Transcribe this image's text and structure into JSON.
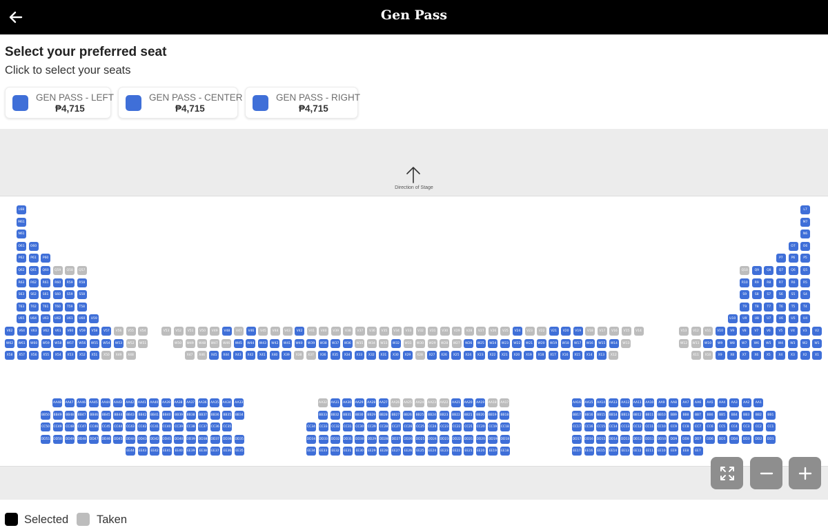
{
  "app": {
    "title": "Gen Pass"
  },
  "page": {
    "heading": "Select your preferred seat",
    "subheading": "Click to select your seats"
  },
  "tickets": [
    {
      "name": "GEN PASS - LEFT",
      "price": "₱4,715"
    },
    {
      "name": "GEN PASS - CENTER",
      "price": "₱4,715"
    },
    {
      "name": "GEN PASS - RIGHT",
      "price": "₱4,715"
    }
  ],
  "map": {
    "stage_label": "Direction of Stage",
    "zoom_buttons": [
      "fullscreen",
      "zoom-out",
      "zoom-in"
    ]
  },
  "legend": {
    "selected": "Selected",
    "taken": "Taken"
  },
  "colors": {
    "available": "#3f6fd8",
    "taken": "#bdbdbd",
    "selected": "#000000",
    "header": "#000000"
  },
  "icons": [
    "back-arrow-icon",
    "up-arrow-icon",
    "fullscreen-icon",
    "minus-icon",
    "plus-icon"
  ],
  "seat_map": {
    "left_wing": [
      {
        "row": "L",
        "seats": [
          "L68"
        ]
      },
      {
        "row": "M",
        "seats": [
          "M61"
        ]
      },
      {
        "row": "N",
        "seats": [
          "N61"
        ]
      },
      {
        "row": "O",
        "seats": [
          "O61",
          "O60"
        ]
      },
      {
        "row": "P",
        "seats": [
          "P62",
          "P61",
          "P60"
        ]
      },
      {
        "row": "Q",
        "seats": [
          "Q62",
          "Q61",
          "Q60",
          "Q59",
          "Q58",
          "Q57"
        ],
        "taken": [
          "Q59",
          "Q58",
          "Q57"
        ]
      },
      {
        "row": "R",
        "seats": [
          "R63",
          "R62",
          "R61",
          "R60",
          "R59",
          "R58"
        ]
      },
      {
        "row": "S",
        "seats": [
          "S63",
          "S62",
          "S61",
          "S60",
          "S59",
          "S58"
        ]
      },
      {
        "row": "T",
        "seats": [
          "T63",
          "T62",
          "T61",
          "T60",
          "T59",
          "T58"
        ]
      },
      {
        "row": "U",
        "seats": [
          "U65",
          "U64",
          "U63",
          "U62",
          "U61",
          "U60",
          "U59"
        ]
      },
      {
        "row": "V",
        "seats": [
          "V62",
          "V64",
          "V63",
          "V62",
          "V61",
          "V60",
          "V59",
          "V58",
          "V57",
          "V56",
          "V55",
          "V54"
        ],
        "taken": [
          "V56",
          "V55",
          "V54"
        ]
      },
      {
        "row": "W",
        "seats": [
          "W62",
          "W61",
          "W60",
          "W59",
          "W58",
          "W57",
          "W56",
          "W55",
          "W54",
          "W53",
          "W52",
          "W51"
        ],
        "taken": [
          "W52",
          "W51"
        ]
      },
      {
        "row": "X",
        "seats": [
          "X58",
          "X57",
          "X56",
          "X55",
          "X54",
          "X53",
          "X52",
          "X51",
          "X50",
          "X49",
          "X48"
        ],
        "taken": [
          "X50",
          "X49",
          "X48"
        ]
      }
    ],
    "center_upper": [
      {
        "row": "V",
        "seats": [
          "V53",
          "V52",
          "V51",
          "V50",
          "V49",
          "V48",
          "V47",
          "V46",
          "V45",
          "V44",
          "V43",
          "V42",
          "V41",
          "V40",
          "V39",
          "V38",
          "V37",
          "V36",
          "V35",
          "V34",
          "V33",
          "V32",
          "V31",
          "V30",
          "V29",
          "V28",
          "V27",
          "V26",
          "V25",
          "V24",
          "V23",
          "V22",
          "V21",
          "V20",
          "V19",
          "V18",
          "V17",
          "V16",
          "V15",
          "V14"
        ],
        "taken": [
          "V53",
          "V52",
          "V51",
          "V50",
          "V49",
          "V47",
          "V45",
          "V44",
          "V43",
          "V41",
          "V40",
          "V39",
          "V38",
          "V37",
          "V36",
          "V35",
          "V34",
          "V33",
          "V32",
          "V31",
          "V30",
          "V29",
          "V28",
          "V27",
          "V26",
          "V25",
          "V23",
          "V22",
          "V18",
          "V17",
          "V16",
          "V15",
          "V14"
        ]
      },
      {
        "row": "W",
        "seats": [
          "W50",
          "W49",
          "W48",
          "W47",
          "W46",
          "W45",
          "W44",
          "W43",
          "W42",
          "W41",
          "W40",
          "W39",
          "W38",
          "W37",
          "W36",
          "W35",
          "W34",
          "W33",
          "W32",
          "W31",
          "W30",
          "W29",
          "W28",
          "W27",
          "W26",
          "W25",
          "W24",
          "W23",
          "W22",
          "W21",
          "W20",
          "W19",
          "W18",
          "W17",
          "W16",
          "W15",
          "W14",
          "W13"
        ],
        "taken": [
          "W50",
          "W49",
          "W48",
          "W47",
          "W46",
          "W35",
          "W34",
          "W33",
          "W31",
          "W30",
          "W29",
          "W28",
          "W27",
          "W13"
        ]
      },
      {
        "row": "X",
        "seats": [
          "X47",
          "X46",
          "X45",
          "X44",
          "X43",
          "X42",
          "X41",
          "X40",
          "X39",
          "X38",
          "X37",
          "X36",
          "X35",
          "X34",
          "X33",
          "X32",
          "X31",
          "X30",
          "X29",
          "X28",
          "X27",
          "X26",
          "X25",
          "X24",
          "X23",
          "X22",
          "X21",
          "X20",
          "X19",
          "X18",
          "X17",
          "X16",
          "X15",
          "X14",
          "X13",
          "X12"
        ],
        "taken": [
          "X47",
          "X46",
          "X38",
          "X37",
          "X28",
          "X12"
        ]
      }
    ],
    "right_wing": [
      {
        "row": "L",
        "seats": [
          "L7"
        ]
      },
      {
        "row": "M",
        "seats": [
          "M7"
        ]
      },
      {
        "row": "N",
        "seats": [
          "N6"
        ]
      },
      {
        "row": "O",
        "seats": [
          "O7",
          "O6"
        ]
      },
      {
        "row": "P",
        "seats": [
          "P7",
          "P6",
          "P5"
        ]
      },
      {
        "row": "Q",
        "seats": [
          "Q10",
          "Q9",
          "Q8",
          "Q7",
          "Q6",
          "Q5"
        ],
        "taken": [
          "Q10"
        ]
      },
      {
        "row": "R",
        "seats": [
          "R10",
          "R9",
          "R8",
          "R7",
          "R6",
          "R5"
        ]
      },
      {
        "row": "S",
        "seats": [
          "S9",
          "S8",
          "S7",
          "S6",
          "S5",
          "S4"
        ]
      },
      {
        "row": "T",
        "seats": [
          "T9",
          "T8",
          "T7",
          "T6",
          "T5",
          "T4"
        ]
      },
      {
        "row": "U",
        "seats": [
          "U10",
          "U9",
          "U8",
          "U7",
          "U6",
          "U5",
          "U4"
        ]
      },
      {
        "row": "V",
        "seats": [
          "V13",
          "V12",
          "V11",
          "V10",
          "V9",
          "V8",
          "V7",
          "V6",
          "V5",
          "V4",
          "V3",
          "V2"
        ],
        "taken": [
          "V13",
          "V12",
          "V11"
        ]
      },
      {
        "row": "W",
        "seats": [
          "W12",
          "W11",
          "W10",
          "W9",
          "W8",
          "W7",
          "W6",
          "W5",
          "W4",
          "W3",
          "W2",
          "W1"
        ],
        "taken": [
          "W12",
          "W11"
        ]
      },
      {
        "row": "X",
        "seats": [
          "X11",
          "X10",
          "X9",
          "X8",
          "X7",
          "X6",
          "X5",
          "X4",
          "X3",
          "X2",
          "X1"
        ],
        "taken": [
          "X11",
          "X10"
        ]
      }
    ],
    "lower_left": [
      {
        "row": "AA",
        "seats": [
          "AA48",
          "AA47",
          "AA46",
          "AA45",
          "AA44",
          "AA43",
          "AA42",
          "AA41",
          "AA40",
          "AA39",
          "AA38",
          "AA37",
          "AA36",
          "AA35",
          "AA34",
          "AA33"
        ]
      },
      {
        "row": "BB",
        "seats": [
          "BB50",
          "BB49",
          "BB48",
          "BB47",
          "BB46",
          "BB45",
          "BB44",
          "BB43",
          "BB42",
          "BB41",
          "BB40",
          "BB39",
          "BB38",
          "BB37",
          "BB36",
          "BB35",
          "BB34"
        ]
      },
      {
        "row": "CC",
        "seats": [
          "CC50",
          "CC49",
          "CC48",
          "CC47",
          "CC46",
          "CC45",
          "CC44",
          "CC43",
          "CC42",
          "CC41",
          "CC40",
          "CC39",
          "CC38",
          "CC37",
          "CC36",
          "CC35"
        ]
      },
      {
        "row": "DD",
        "seats": [
          "DD51",
          "DD50",
          "DD49",
          "DD48",
          "DD47",
          "DD46",
          "DD45",
          "DD44",
          "DD43",
          "DD42",
          "DD41",
          "DD40",
          "DD39",
          "DD38",
          "DD37",
          "DD36",
          "DD35"
        ]
      },
      {
        "row": "EE",
        "seats": [
          "EE44",
          "EE43",
          "EE42",
          "EE41",
          "EE40",
          "EE39",
          "EE38",
          "EE37",
          "EE36",
          "EE35"
        ]
      }
    ],
    "lower_center": [
      {
        "row": "AA",
        "seats": [
          "AA32",
          "AA31",
          "AA30",
          "AA29",
          "AA28",
          "AA27",
          "AA26",
          "AA25",
          "AA24",
          "AA23",
          "AA22",
          "AA21",
          "AA20",
          "AA19",
          "AA18",
          "AA17"
        ],
        "taken": [
          "AA32",
          "AA26",
          "AA25",
          "AA24",
          "AA23",
          "AA22",
          "AA18",
          "AA17"
        ]
      },
      {
        "row": "BB",
        "seats": [
          "BB33",
          "BB32",
          "BB31",
          "BB30",
          "BB29",
          "BB28",
          "BB27",
          "BB26",
          "BB25",
          "BB24",
          "BB23",
          "BB22",
          "BB21",
          "BB20",
          "BB19",
          "BB18"
        ]
      },
      {
        "row": "CC",
        "seats": [
          "CC34",
          "CC33",
          "CC32",
          "CC31",
          "CC30",
          "CC29",
          "CC28",
          "CC27",
          "CC26",
          "CC25",
          "CC24",
          "CC23",
          "CC22",
          "CC21",
          "CC20",
          "CC19",
          "CC18"
        ]
      },
      {
        "row": "DD",
        "seats": [
          "DD34",
          "DD33",
          "DD32",
          "DD31",
          "DD30",
          "DD29",
          "DD28",
          "DD27",
          "DD26",
          "DD25",
          "DD24",
          "DD23",
          "DD22",
          "DD21",
          "DD20",
          "DD19",
          "DD18"
        ]
      },
      {
        "row": "EE",
        "seats": [
          "EE34",
          "EE33",
          "EE32",
          "EE31",
          "EE30",
          "EE29",
          "EE28",
          "EE27",
          "EE26",
          "EE25",
          "EE24",
          "EE23",
          "EE22",
          "EE21",
          "EE20",
          "EE19",
          "EE18"
        ]
      }
    ],
    "lower_right": [
      {
        "row": "AA",
        "seats": [
          "AA16",
          "AA15",
          "AA14",
          "AA13",
          "AA12",
          "AA11",
          "AA10",
          "AA9",
          "AA8",
          "AA7",
          "AA6",
          "AA5",
          "AA4",
          "AA3",
          "AA2",
          "AA1"
        ]
      },
      {
        "row": "BB",
        "seats": [
          "BB17",
          "BB16",
          "BB15",
          "BB14",
          "BB13",
          "BB12",
          "BB11",
          "BB10",
          "BB9",
          "BB8",
          "BB7",
          "BB6",
          "BB5",
          "BB4",
          "BB3",
          "BB2",
          "BB1"
        ]
      },
      {
        "row": "CC",
        "seats": [
          "CC17",
          "CC16",
          "CC15",
          "CC14",
          "CC13",
          "CC12",
          "CC11",
          "CC10",
          "CC9",
          "CC8",
          "CC7",
          "CC6",
          "CC5",
          "CC4",
          "CC3",
          "CC2",
          "CC1"
        ]
      },
      {
        "row": "DD",
        "seats": [
          "DD17",
          "DD16",
          "DD15",
          "DD14",
          "DD13",
          "DD12",
          "DD11",
          "DD10",
          "DD9",
          "DD8",
          "DD7",
          "DD6",
          "DD5",
          "DD4",
          "DD3",
          "DD2",
          "DD1"
        ]
      },
      {
        "row": "EE",
        "seats": [
          "EE17",
          "EE16",
          "EE15",
          "EE14",
          "EE13",
          "EE12",
          "EE11",
          "EE10",
          "EE9",
          "EE8",
          "EE7"
        ]
      }
    ]
  }
}
